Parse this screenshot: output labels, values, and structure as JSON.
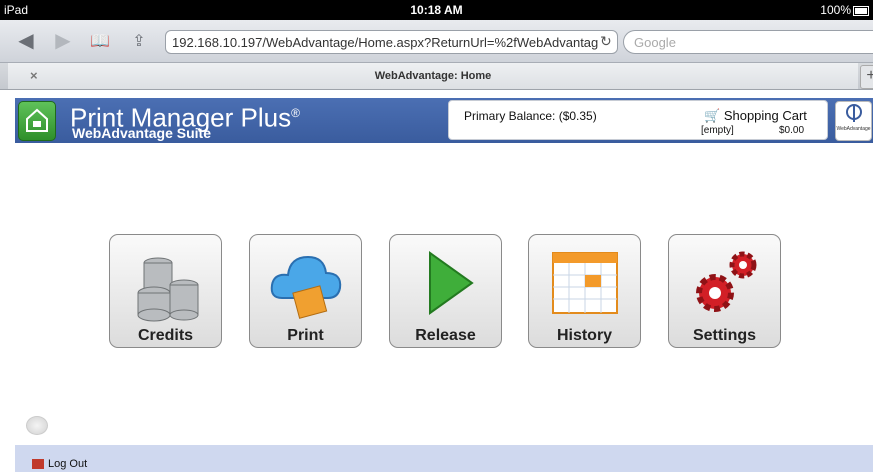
{
  "status_bar": {
    "device": "iPad",
    "time": "10:18 AM",
    "battery": "100%"
  },
  "browser": {
    "url": "192.168.10.197/WebAdvantage/Home.aspx?ReturnUrl=%2fWebAdvantag",
    "search_placeholder": "Google",
    "tab_title": "WebAdvantage: Home"
  },
  "header": {
    "brand": "Print Manager Plus",
    "brand_mark": "®",
    "subtitle": "WebAdvantage Suite",
    "balance": "Primary Balance: ($0.35)",
    "cart_label": "Shopping Cart",
    "cart_status": "[empty]",
    "cart_total": "$0.00"
  },
  "tiles": [
    {
      "label": "Credits",
      "icon": "coins-icon"
    },
    {
      "label": "Print",
      "icon": "cloud-print-icon"
    },
    {
      "label": "Release",
      "icon": "play-icon"
    },
    {
      "label": "History",
      "icon": "calendar-icon"
    },
    {
      "label": "Settings",
      "icon": "gears-icon"
    }
  ],
  "footer": {
    "logout": "Log Out"
  }
}
